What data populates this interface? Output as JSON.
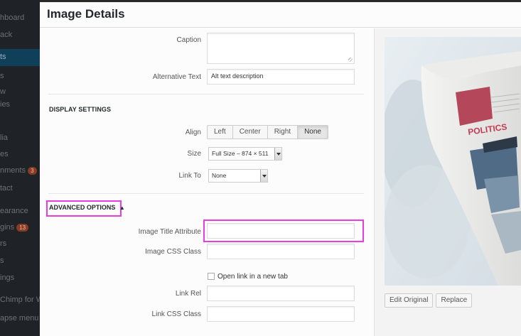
{
  "wp_sidebar": {
    "items": [
      {
        "label": "hboard"
      },
      {
        "label": "ack"
      },
      {
        "label": "ts",
        "active": true
      },
      {
        "label": "s"
      },
      {
        "label": "w"
      },
      {
        "label": "ies"
      },
      {
        "label": "lia"
      },
      {
        "label": "es"
      },
      {
        "label": "nments",
        "badge": "3"
      },
      {
        "label": "tact"
      },
      {
        "label": "earance"
      },
      {
        "label": "gins",
        "badge": "13"
      },
      {
        "label": "rs"
      },
      {
        "label": "s"
      },
      {
        "label": "ings"
      },
      {
        "label": "Chimp for W"
      },
      {
        "label": "apse menu"
      }
    ]
  },
  "modal": {
    "title": "Image Details"
  },
  "settings": {
    "caption_label": "Caption",
    "caption_value": "",
    "alt_label": "Alternative Text",
    "alt_value": "Alt text description",
    "display_heading": "DISPLAY SETTINGS",
    "align_label": "Align",
    "align_options": [
      "Left",
      "Center",
      "Right",
      "None"
    ],
    "align_selected": "None",
    "size_label": "Size",
    "size_value": "Full Size – 874 × 511",
    "linkto_label": "Link To",
    "linkto_value": "None",
    "advanced_label": "ADVANCED OPTIONS",
    "advanced_arrow": "▲",
    "title_attr_label": "Image Title Attribute",
    "title_attr_value": "",
    "css_class_label": "Image CSS Class",
    "css_class_value": "",
    "new_tab_label": "Open link in a new tab",
    "new_tab_checked": false,
    "link_rel_label": "Link Rel",
    "link_rel_value": "",
    "link_css_label": "Link CSS Class",
    "link_css_value": ""
  },
  "preview": {
    "headline": "POLITICS",
    "edit_original_label": "Edit Original",
    "replace_label": "Replace"
  },
  "colors": {
    "highlight": "#e83ee0",
    "sidebar_bg": "#1f2226",
    "sidebar_active": "#103f5a",
    "badge": "#8a3b22",
    "politics_banner": "#b5475a"
  }
}
